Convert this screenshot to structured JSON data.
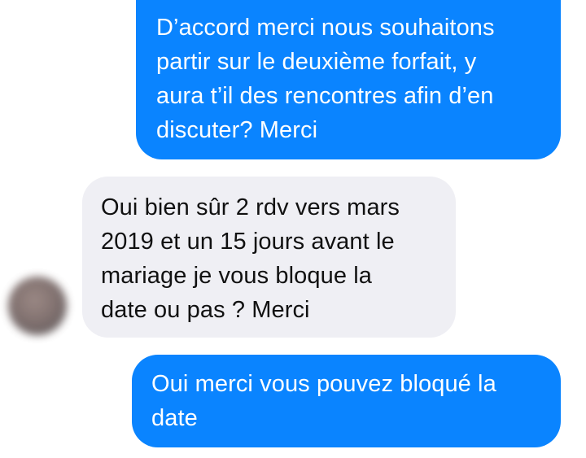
{
  "conversation": {
    "messages": [
      {
        "direction": "sent",
        "text": "D’accord merci nous souhaitons\npartir sur le deuxième forfait, y\naura t’il des rencontres afin d’en\ndiscuter? Merci"
      },
      {
        "direction": "received",
        "text": "Oui bien sûr 2 rdv vers mars\n2019 et un 15 jours avant le\nmariage je vous bloque la\ndate ou pas ? Merci"
      },
      {
        "direction": "sent",
        "text": "Oui merci vous pouvez bloqué la\ndate"
      }
    ],
    "contact_avatar_icon": "blurred-profile-avatar"
  },
  "colors": {
    "sent_bubble": "#0a84ff",
    "received_bubble": "#efeff4",
    "sent_text": "#ffffff",
    "received_text": "#111111"
  }
}
